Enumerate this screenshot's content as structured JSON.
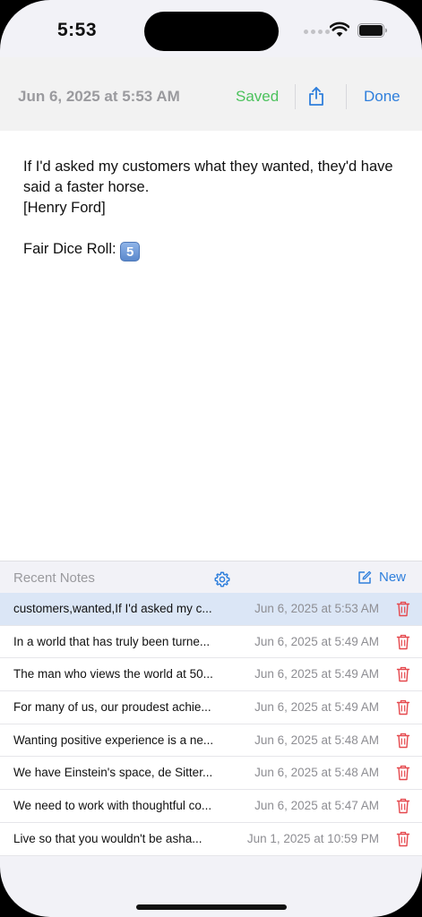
{
  "status_bar": {
    "time": "5:53"
  },
  "header": {
    "date": "Jun 6, 2025 at 5:53 AM",
    "saved_label": "Saved",
    "done_label": "Done"
  },
  "note": {
    "text": "If I'd asked my customers what they wanted, they'd have said a faster horse.\n[Henry Ford]\n\nFair Dice Roll: ",
    "dice_value": "5"
  },
  "recent": {
    "title": "Recent Notes",
    "new_label": "New",
    "items": [
      {
        "preview": "customers,wanted,If I'd asked my c...",
        "date": "Jun 6, 2025 at 5:53 AM",
        "selected": true
      },
      {
        "preview": "In a world that has truly been turne...",
        "date": "Jun 6, 2025 at 5:49 AM"
      },
      {
        "preview": "The man who views the world at 50...",
        "date": "Jun 6, 2025 at 5:49 AM"
      },
      {
        "preview": "For many of us, our proudest achie...",
        "date": "Jun 6, 2025 at 5:49 AM"
      },
      {
        "preview": "Wanting positive experience is a ne...",
        "date": "Jun 6, 2025 at 5:48 AM"
      },
      {
        "preview": "We have Einstein's space, de Sitter...",
        "date": "Jun 6, 2025 at 5:48 AM"
      },
      {
        "preview": "We need to work with thoughtful co...",
        "date": "Jun 6, 2025 at 5:47 AM"
      },
      {
        "preview": "Live so that you wouldn't be asha...",
        "date": "Jun 1, 2025 at 10:59 PM"
      }
    ]
  },
  "colors": {
    "accent": "#2f7fdc",
    "saved": "#4cc25d",
    "delete": "#e5484d",
    "selected_row": "#dbe6f6"
  },
  "icons": [
    "wifi-icon",
    "battery-icon",
    "share-icon",
    "gear-icon",
    "compose-icon",
    "trash-icon"
  ]
}
